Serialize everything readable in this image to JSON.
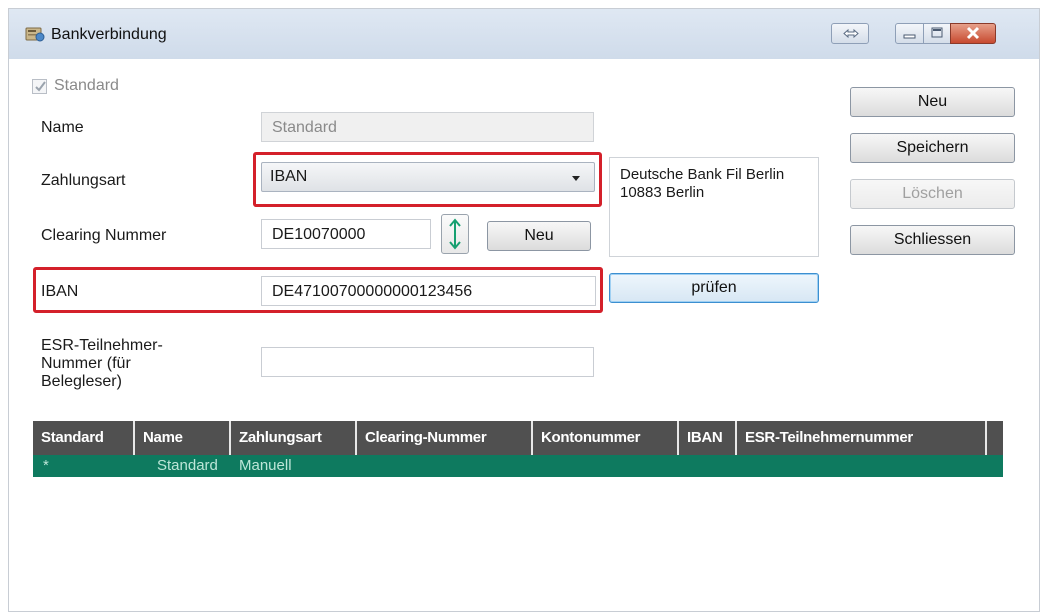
{
  "window": {
    "title": "Bankverbindung",
    "controls": [
      "swap-icon",
      "minimize-icon",
      "maximize-icon",
      "close-icon"
    ]
  },
  "form": {
    "standard_label": "Standard",
    "standard_checked": true,
    "name_label": "Name",
    "name_value": "Standard",
    "zahlungsart_label": "Zahlungsart",
    "zahlungsart_value": "IBAN",
    "clearing_label": "Clearing Nummer",
    "clearing_value": "DE10070000",
    "clearing_new_button": "Neu",
    "iban_label": "IBAN",
    "iban_value": "DE47100700000000123456",
    "check_button": "prüfen",
    "esr_label_line1": "ESR-Teilnehmer-",
    "esr_label_line2": "Nummer (für",
    "esr_label_line3": "Belegleser)",
    "esr_value": "",
    "bank_address_line1": "Deutsche Bank Fil Berlin",
    "bank_address_line2": "10883 Berlin"
  },
  "actions": {
    "new": "Neu",
    "save": "Speichern",
    "delete": "Löschen",
    "close": "Schliessen"
  },
  "grid": {
    "columns": [
      "Standard",
      "Name",
      "Zahlungsart",
      "Clearing-Nummer",
      "Kontonummer",
      "IBAN",
      "ESR-Teilnehmernummer"
    ],
    "rows": [
      {
        "standard": "*",
        "name": "Standard",
        "zahlungsart": "Manuell"
      }
    ],
    "header_color": "#505050",
    "selected_row_color": "#0e7a5f"
  },
  "highlight_color": "#d4202a"
}
